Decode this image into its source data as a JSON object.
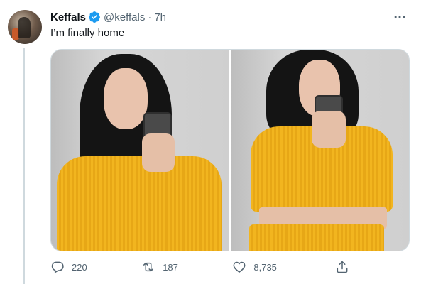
{
  "tweet": {
    "display_name": "Keffals",
    "handle": "@keffals",
    "separator": "·",
    "time": "7h",
    "text": "I’m finally home",
    "verified": true
  },
  "metrics": {
    "replies": "220",
    "retweets": "187",
    "likes": "8,735"
  },
  "icons": {
    "verified": "verified-badge-icon",
    "more": "more-horizontal-icon",
    "reply": "reply-icon",
    "retweet": "retweet-icon",
    "like": "heart-icon",
    "share": "share-icon"
  },
  "colors": {
    "verified_blue": "#1d9bf0",
    "secondary_text": "#536471",
    "border": "#cfd9de"
  }
}
